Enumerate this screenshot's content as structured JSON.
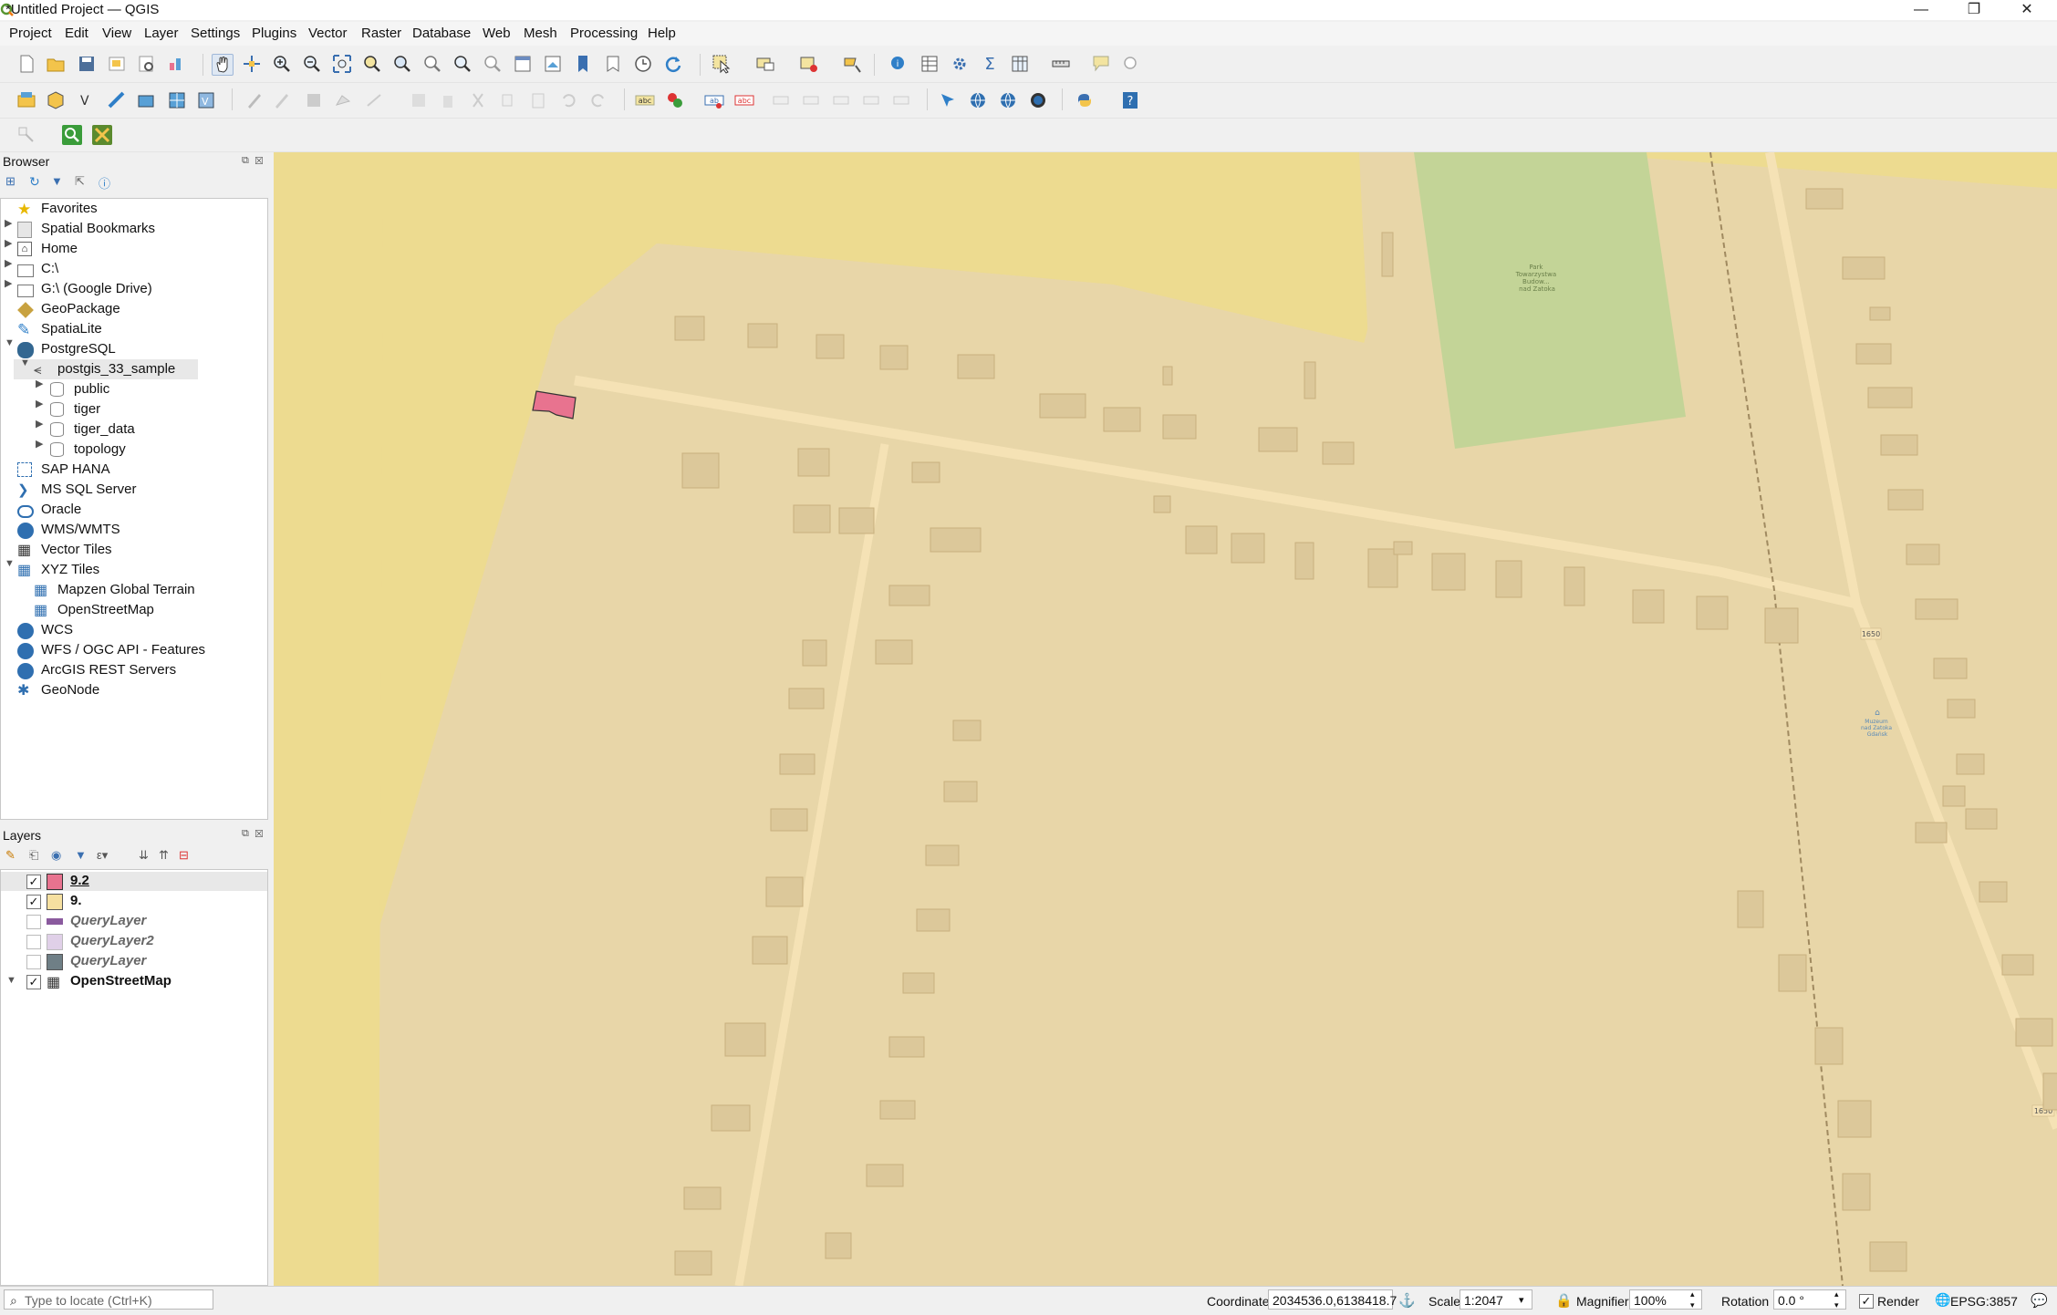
{
  "window": {
    "title": "*Untitled Project — QGIS",
    "minimize": "—",
    "maximize": "❐",
    "close": "✕"
  },
  "menubar": [
    "Project",
    "Edit",
    "View",
    "Layer",
    "Settings",
    "Plugins",
    "Vector",
    "Raster",
    "Database",
    "Web",
    "Mesh",
    "Processing",
    "Help"
  ],
  "browser": {
    "title": "Browser",
    "items": [
      {
        "label": "Favorites",
        "icon": "star-icon"
      },
      {
        "label": "Spatial Bookmarks",
        "icon": "bookmark-icon"
      },
      {
        "label": "Home",
        "icon": "home-folder-icon"
      },
      {
        "label": "C:\\",
        "icon": "folder-icon"
      },
      {
        "label": "G:\\ (Google Drive)",
        "icon": "folder-icon"
      },
      {
        "label": "GeoPackage",
        "icon": "geopackage-icon"
      },
      {
        "label": "SpatiaLite",
        "icon": "spatialite-icon"
      },
      {
        "label": "PostgreSQL",
        "icon": "postgresql-icon"
      },
      {
        "label": "postgis_33_sample",
        "icon": "connection-icon"
      },
      {
        "label": "public",
        "icon": "schema-icon"
      },
      {
        "label": "tiger",
        "icon": "schema-icon"
      },
      {
        "label": "tiger_data",
        "icon": "schema-icon"
      },
      {
        "label": "topology",
        "icon": "schema-icon"
      },
      {
        "label": "SAP HANA",
        "icon": "hana-icon"
      },
      {
        "label": "MS SQL Server",
        "icon": "mssql-icon"
      },
      {
        "label": "Oracle",
        "icon": "oracle-icon"
      },
      {
        "label": "WMS/WMTS",
        "icon": "globe-icon"
      },
      {
        "label": "Vector Tiles",
        "icon": "grid-icon"
      },
      {
        "label": "XYZ Tiles",
        "icon": "tiles-icon"
      },
      {
        "label": "Mapzen Global Terrain",
        "icon": "tiles-icon"
      },
      {
        "label": "OpenStreetMap",
        "icon": "tiles-icon"
      },
      {
        "label": "WCS",
        "icon": "globe-icon"
      },
      {
        "label": "WFS / OGC API - Features",
        "icon": "globe-icon"
      },
      {
        "label": "ArcGIS REST Servers",
        "icon": "globe-icon"
      },
      {
        "label": "GeoNode",
        "icon": "geonode-icon"
      }
    ]
  },
  "layers": {
    "title": "Layers",
    "items": [
      {
        "label": "9.2",
        "checked": true,
        "color": "#e8738f"
      },
      {
        "label": "9.",
        "checked": true,
        "color": "#f6e0a0"
      },
      {
        "label": "QueryLayer",
        "checked": false,
        "color": "#8a5a9e"
      },
      {
        "label": "QueryLayer2",
        "checked": false,
        "color": "#e0d0e8"
      },
      {
        "label": "QueryLayer",
        "checked": false,
        "color": "#6f7f86"
      },
      {
        "label": "OpenStreetMap",
        "checked": true,
        "color": "#333333"
      }
    ]
  },
  "map": {
    "road_label": "1650",
    "park_label_lines": [
      "Park",
      "Towarzystwa",
      "Budow...",
      "nad Zatoka"
    ],
    "poi_label_lines": [
      "Muzeum",
      "nad Zatoka",
      "Gdańsk"
    ]
  },
  "statusbar": {
    "locate_placeholder": "Type to locate (Ctrl+K)",
    "coordinate_label": "Coordinate",
    "coordinate_value": "2034536.0,6138418.7",
    "scale_label": "Scale",
    "scale_value": "1:2047",
    "magnifier_label": "Magnifier",
    "magnifier_value": "100%",
    "rotation_label": "Rotation",
    "rotation_value": "0.0 °",
    "render_label": "Render",
    "render_checked": true,
    "crs": "EPSG:3857"
  },
  "colors": {
    "selected_feature": "#e8738f",
    "residential": "#e8d6a8",
    "farmland": "#eddb90",
    "park": "#c3d497",
    "building": "#dcc89a",
    "road": "#f5e2b5"
  }
}
